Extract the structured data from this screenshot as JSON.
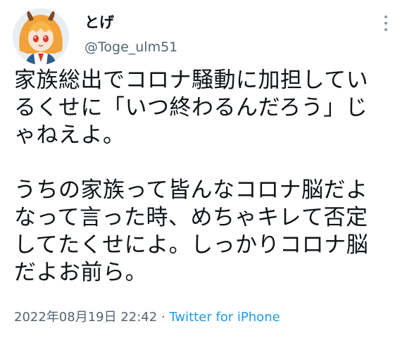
{
  "user": {
    "display_name": "とげ",
    "handle": "@Toge_ulm51",
    "avatar_icon": "avatar-anime-girl-icon"
  },
  "tweet": {
    "lines": [
      "家族総出でコロナ騒動に加担してい",
      "るくせに「いつ終わるんだろう」じ",
      "ゃねえよ。",
      "",
      "うちの家族って皆んなコロナ脳だよ",
      "なって言った時、めちゃキレて否定",
      "してたくせによ。しっかりコロナ脳",
      "だよお前ら。"
    ]
  },
  "meta": {
    "timestamp": "2022年08月19日 22:42",
    "separator": " · ",
    "source": "Twitter for iPhone"
  },
  "menu": {
    "icon": "more-vertical-icon"
  },
  "colors": {
    "text_primary": "#0f1419",
    "text_secondary": "#536471",
    "link": "#1d9bf0"
  }
}
